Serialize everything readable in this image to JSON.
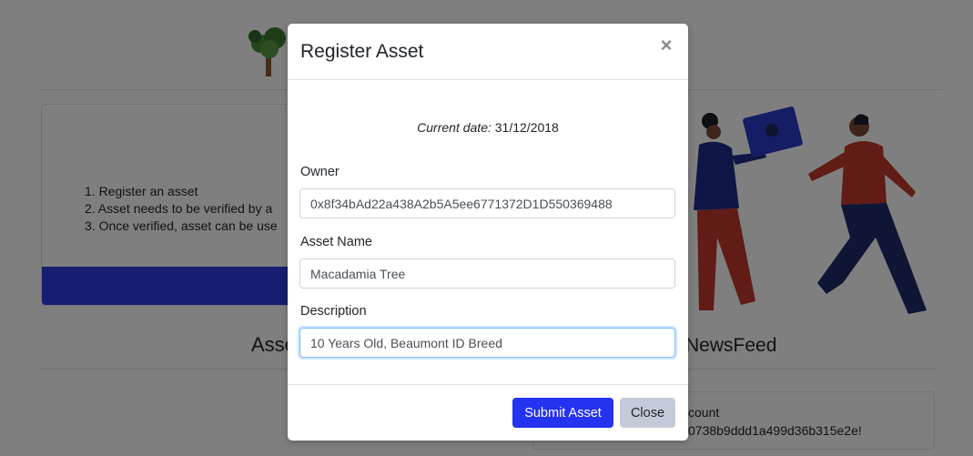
{
  "page": {
    "steps": [
      "1. Register an asset",
      "2. Asset needs to be verified by a",
      "3. Once verified, asset can be use"
    ],
    "assets_heading": "Asse",
    "newsfeed_heading": "NewsFeed",
    "news_line1": "count",
    "news_line2": "0738b9ddd1a499d36b315e2e!"
  },
  "modal": {
    "title": "Register Asset",
    "close_symbol": "×",
    "current_date_label": "Current date:",
    "current_date_value": "31/12/2018",
    "owner_label": "Owner",
    "owner_value": "0x8f34bAd22a438A2b5A5ee6771372D1D550369488",
    "asset_name_label": "Asset Name",
    "asset_name_value": "Macadamia Tree",
    "description_label": "Description",
    "description_value": "10 Years Old, Beaumont ID Breed",
    "submit_label": "Submit Asset",
    "close_label": "Close"
  },
  "colors": {
    "primary": "#2433f0",
    "secondary": "#c4cbd8",
    "focus_border": "#80bdff"
  }
}
